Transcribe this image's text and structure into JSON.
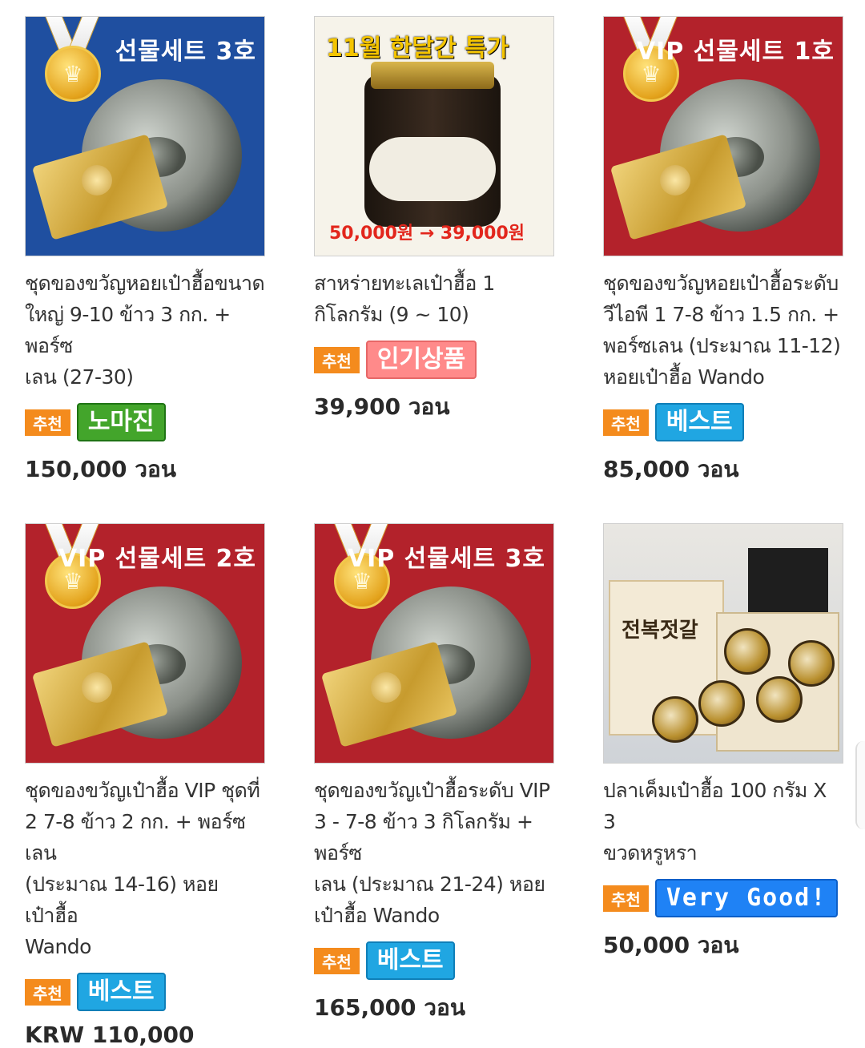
{
  "products": [
    {
      "image_text": "선물세트 3호",
      "title_lines": [
        "ชุดของขวัญหอยเป๋าฮื้อขนาด",
        "ใหญ่ 9-10 ข้าว 3 กก. + พอร์ซ",
        "เลน (27-30)"
      ],
      "rec": "추천",
      "badge": "노마진",
      "price": "150,000 วอน"
    },
    {
      "image_text_top": "11월 한달간 특가",
      "image_text_bottom": "50,000원 → 39,000원",
      "title_lines": [
        "สาหร่ายทะเลเป๋าฮื้อ 1",
        "กิโลกรัม (9 ~ 10)"
      ],
      "rec": "추천",
      "badge": "인기상품",
      "price": "39,900 วอน"
    },
    {
      "image_text": "VIP 선물세트 1호",
      "title_lines": [
        "ชุดของขวัญหอยเป๋าฮื้อระดับ",
        "วีไอพี 1 7-8 ข้าว 1.5 กก. +",
        "พอร์ซเลน (ประมาณ 11-12)",
        "หอยเป๋าฮื้อ Wando"
      ],
      "rec": "추천",
      "badge": "베스트",
      "price": "85,000 วอน"
    },
    {
      "image_text": "VIP 선물세트 2호",
      "title_lines": [
        "ชุดของขวัญเป๋าฮื้อ VIP ชุดที่",
        "2 7-8 ข้าว 2 กก. + พอร์ซเลน",
        "(ประมาณ 14-16) หอยเป๋าฮื้อ",
        "Wando"
      ],
      "rec": "추천",
      "badge": "베스트",
      "price": "KRW 110,000"
    },
    {
      "image_text": "VIP 선물세트 3호",
      "title_lines": [
        "ชุดของขวัญเป๋าฮื้อระดับ VIP",
        "3 - 7-8 ข้าว 3 กิโลกรัม + พอร์ซ",
        "เลน (ประมาณ 21-24) หอย",
        "เป๋าฮื้อ Wando"
      ],
      "rec": "추천",
      "badge": "베스트",
      "price": "165,000 วอน"
    },
    {
      "image_text": "전복젓갈",
      "title_lines": [
        "ปลาเค็มเป๋าฮื้อ 100 กรัม X 3",
        "ขวดหรูหรา"
      ],
      "rec": "추천",
      "badge": "Very Good!",
      "price": "50,000 วอน"
    }
  ],
  "colors": {
    "rec_badge": "#f48b1d",
    "nomargin_badge": "#43a52b",
    "popular_badge": "#ff8a8a",
    "best_badge": "#20a6e2",
    "verygood_badge": "#1f82f5"
  }
}
